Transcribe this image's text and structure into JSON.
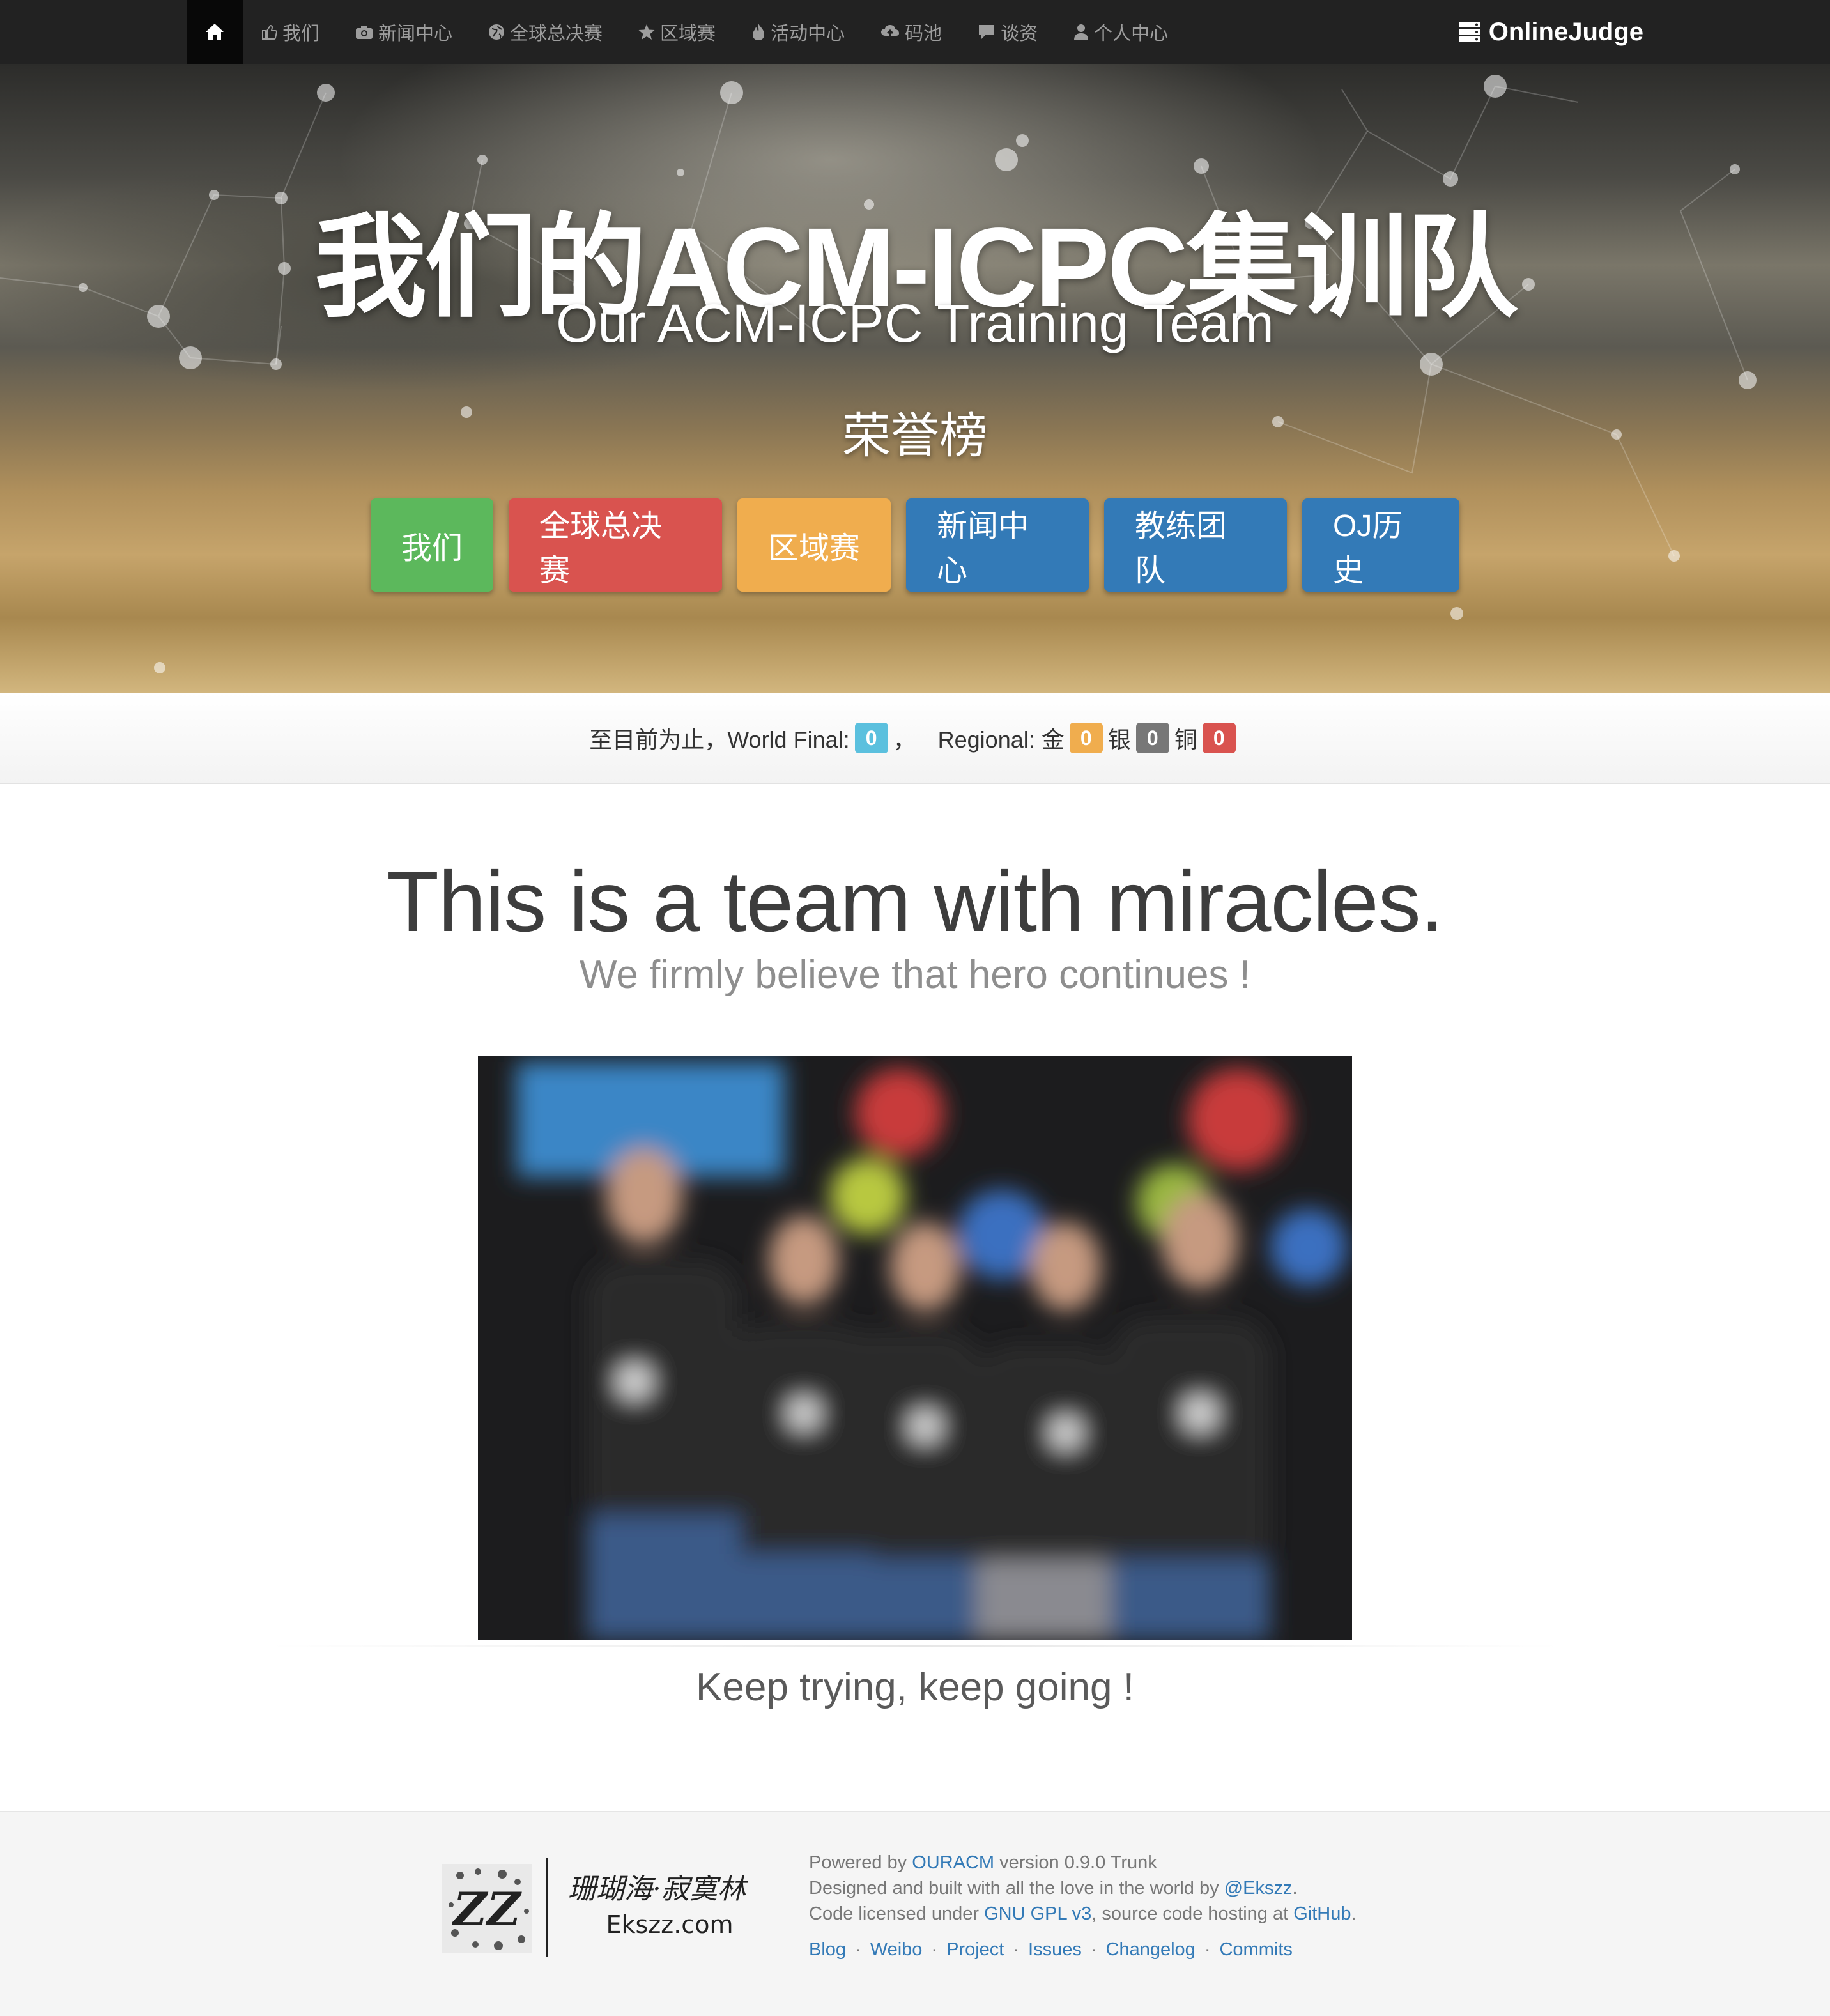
{
  "navbar": {
    "home_icon": "home-icon",
    "items": [
      {
        "label": "我们",
        "icon": "thumbs-up-icon"
      },
      {
        "label": "新闻中心",
        "icon": "camera-icon"
      },
      {
        "label": "全球总决赛",
        "icon": "globe-icon"
      },
      {
        "label": "区域赛",
        "icon": "star-icon"
      },
      {
        "label": "活动中心",
        "icon": "fire-icon"
      },
      {
        "label": "码池",
        "icon": "cloud-upload-icon"
      },
      {
        "label": "谈资",
        "icon": "comment-icon"
      },
      {
        "label": "个人中心",
        "icon": "user-icon"
      }
    ],
    "brand": "OnlineJudge",
    "brand_icon": "server-icon"
  },
  "hero": {
    "title": "我们的ACM-ICPC集训队",
    "subtitle": "Our ACM-ICPC Training Team",
    "honor": "荣誉榜",
    "buttons": [
      {
        "label": "我们",
        "color": "#5cb85c"
      },
      {
        "label": "全球总决赛",
        "color": "#d9534f"
      },
      {
        "label": "区域赛",
        "color": "#f0ad4e"
      },
      {
        "label": "新闻中心",
        "color": "#337ab7"
      },
      {
        "label": "教练团队",
        "color": "#337ab7"
      },
      {
        "label": "OJ历史",
        "color": "#337ab7"
      }
    ]
  },
  "stats": {
    "prefix": "至目前为止，World Final:",
    "world_final": "0",
    "sep": "，",
    "regional_label": "Regional: 金",
    "gold": "0",
    "silver_label": "银",
    "silver": "0",
    "bronze_label": "铜",
    "bronze": "0"
  },
  "main": {
    "heading": "This is a team with miracles.",
    "subheading": "We firmly believe that hero continues !",
    "tagline": "Keep trying, keep going !"
  },
  "footer": {
    "logo_text": "珊瑚海·寂寞林",
    "logo_domain": "Ekszz.com",
    "logo_mark": "ZZ",
    "line1_prefix": "Powered by ",
    "line1_link": "OURACM",
    "line1_suffix": " version 0.9.0 Trunk",
    "line2_prefix": "Designed and built with all the love in the world by ",
    "line2_link": "@Ekszz",
    "line2_suffix": ".",
    "line3_prefix": "Code licensed under ",
    "line3_link1": "GNU GPL v3",
    "line3_mid": ", source code hosting at ",
    "line3_link2": "GitHub",
    "line3_suffix": ".",
    "links": [
      "Blog",
      "Weibo",
      "Project",
      "Issues",
      "Changelog",
      "Commits"
    ],
    "link_sep": "·"
  },
  "colors": {
    "navbar_bg": "#222222",
    "link": "#337ab7",
    "success": "#5cb85c",
    "danger": "#d9534f",
    "warning": "#f0ad4e",
    "info": "#5bc0de"
  }
}
